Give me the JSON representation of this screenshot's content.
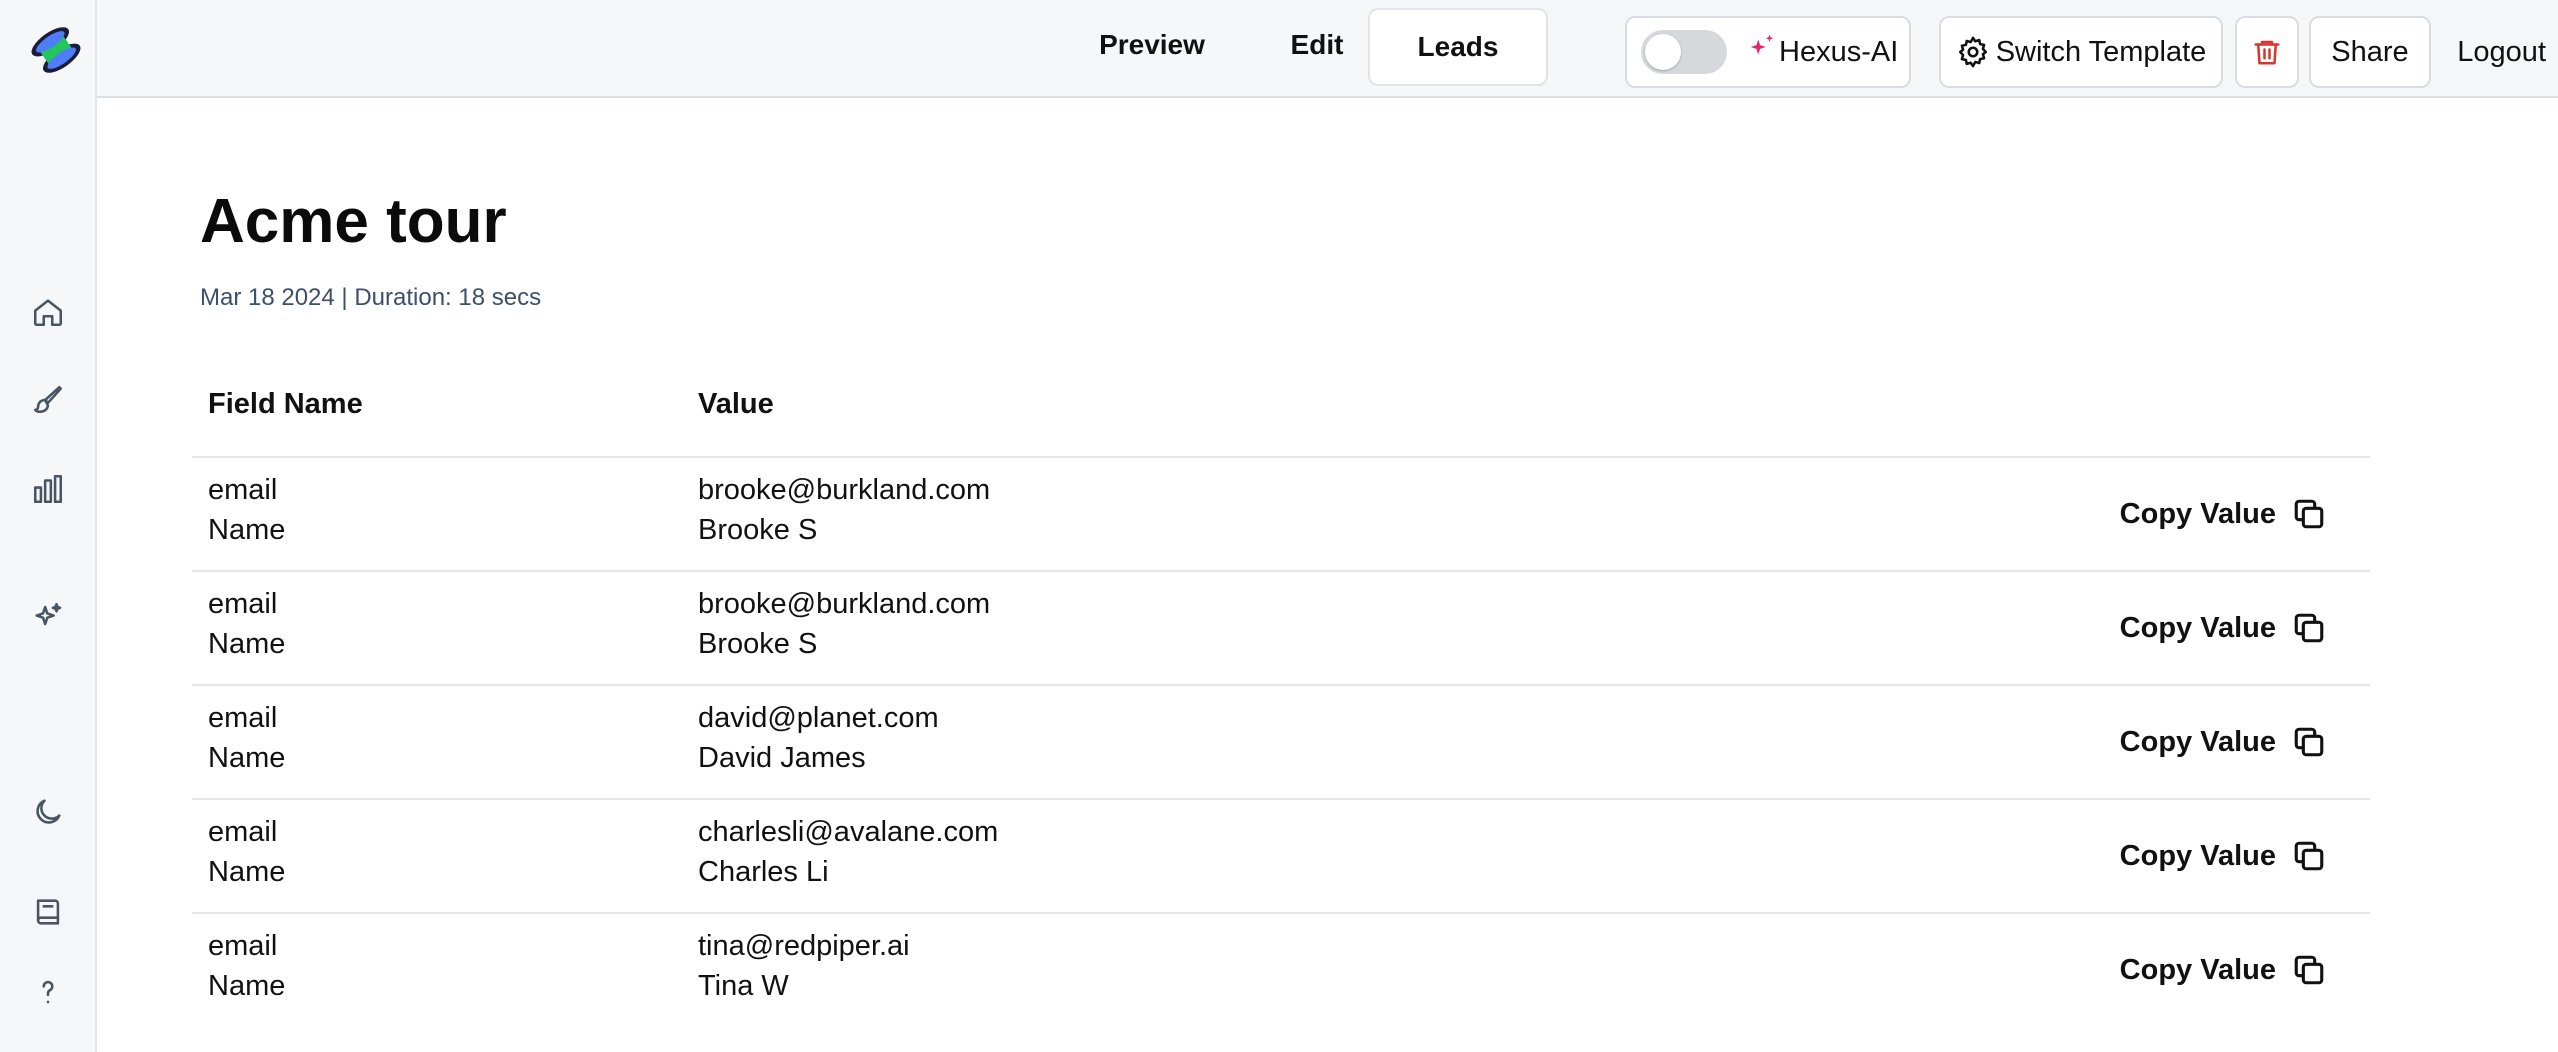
{
  "topbar": {
    "tabs": [
      {
        "label": "Preview"
      },
      {
        "label": "Edit"
      },
      {
        "label": "Leads",
        "active": true
      }
    ],
    "ai_toggle_label": "Hexus-AI",
    "ai_toggle_on": false,
    "switch_template_label": "Switch Template",
    "share_label": "Share",
    "logout_label": "Logout"
  },
  "sidebar": {
    "icons": [
      "home-icon",
      "brush-icon",
      "bar-chart-icon",
      "sparkles-icon",
      "moon-icon",
      "book-icon",
      "help-icon"
    ]
  },
  "page": {
    "title": "Acme tour",
    "subtitle": "Mar 18 2024 | Duration: 18 secs"
  },
  "table": {
    "headers": {
      "field": "Field Name",
      "value": "Value"
    },
    "copy_label": "Copy Value",
    "rows": [
      {
        "field1": "email",
        "value1": "brooke@burkland.com",
        "field2": "Name",
        "value2": "Brooke S"
      },
      {
        "field1": "email",
        "value1": "brooke@burkland.com",
        "field2": "Name",
        "value2": "Brooke S"
      },
      {
        "field1": "email",
        "value1": "david@planet.com",
        "field2": "Name",
        "value2": "David James"
      },
      {
        "field1": "email",
        "value1": "charlesli@avalane.com",
        "field2": "Name",
        "value2": "Charles Li"
      },
      {
        "field1": "email",
        "value1": "tina@redpiper.ai",
        "field2": "Name",
        "value2": "Tina W"
      }
    ]
  },
  "colors": {
    "sparkle": "#e0286e",
    "delete": "#d9342b",
    "subtitle": "#3c4f6b"
  }
}
